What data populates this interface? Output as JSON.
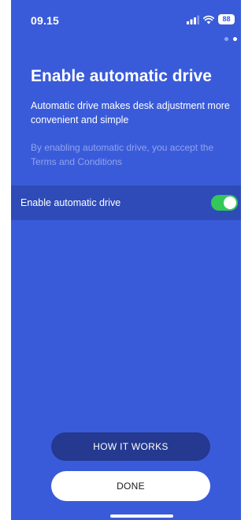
{
  "status_bar": {
    "time": "09.15",
    "battery": "88",
    "icons": [
      "signal-icon",
      "wifi-icon",
      "battery-icon"
    ]
  },
  "pager": {
    "total": 2,
    "active": 2
  },
  "onboarding": {
    "title": "Enable automatic drive",
    "description": "Automatic drive makes desk adjustment more convenient and simple",
    "terms": "By enabling automatic drive, you accept the Terms and Conditions"
  },
  "toggle": {
    "label": "Enable automatic drive",
    "state": "on"
  },
  "buttons": {
    "how_it_works": "HOW IT WORKS",
    "done": "DONE"
  },
  "colors": {
    "background": "#3a5bd9",
    "toggle_row": "#2f4bb8",
    "toggle_on": "#34c759",
    "secondary_button": "#24398f",
    "terms_text": "#8fa3ee"
  }
}
